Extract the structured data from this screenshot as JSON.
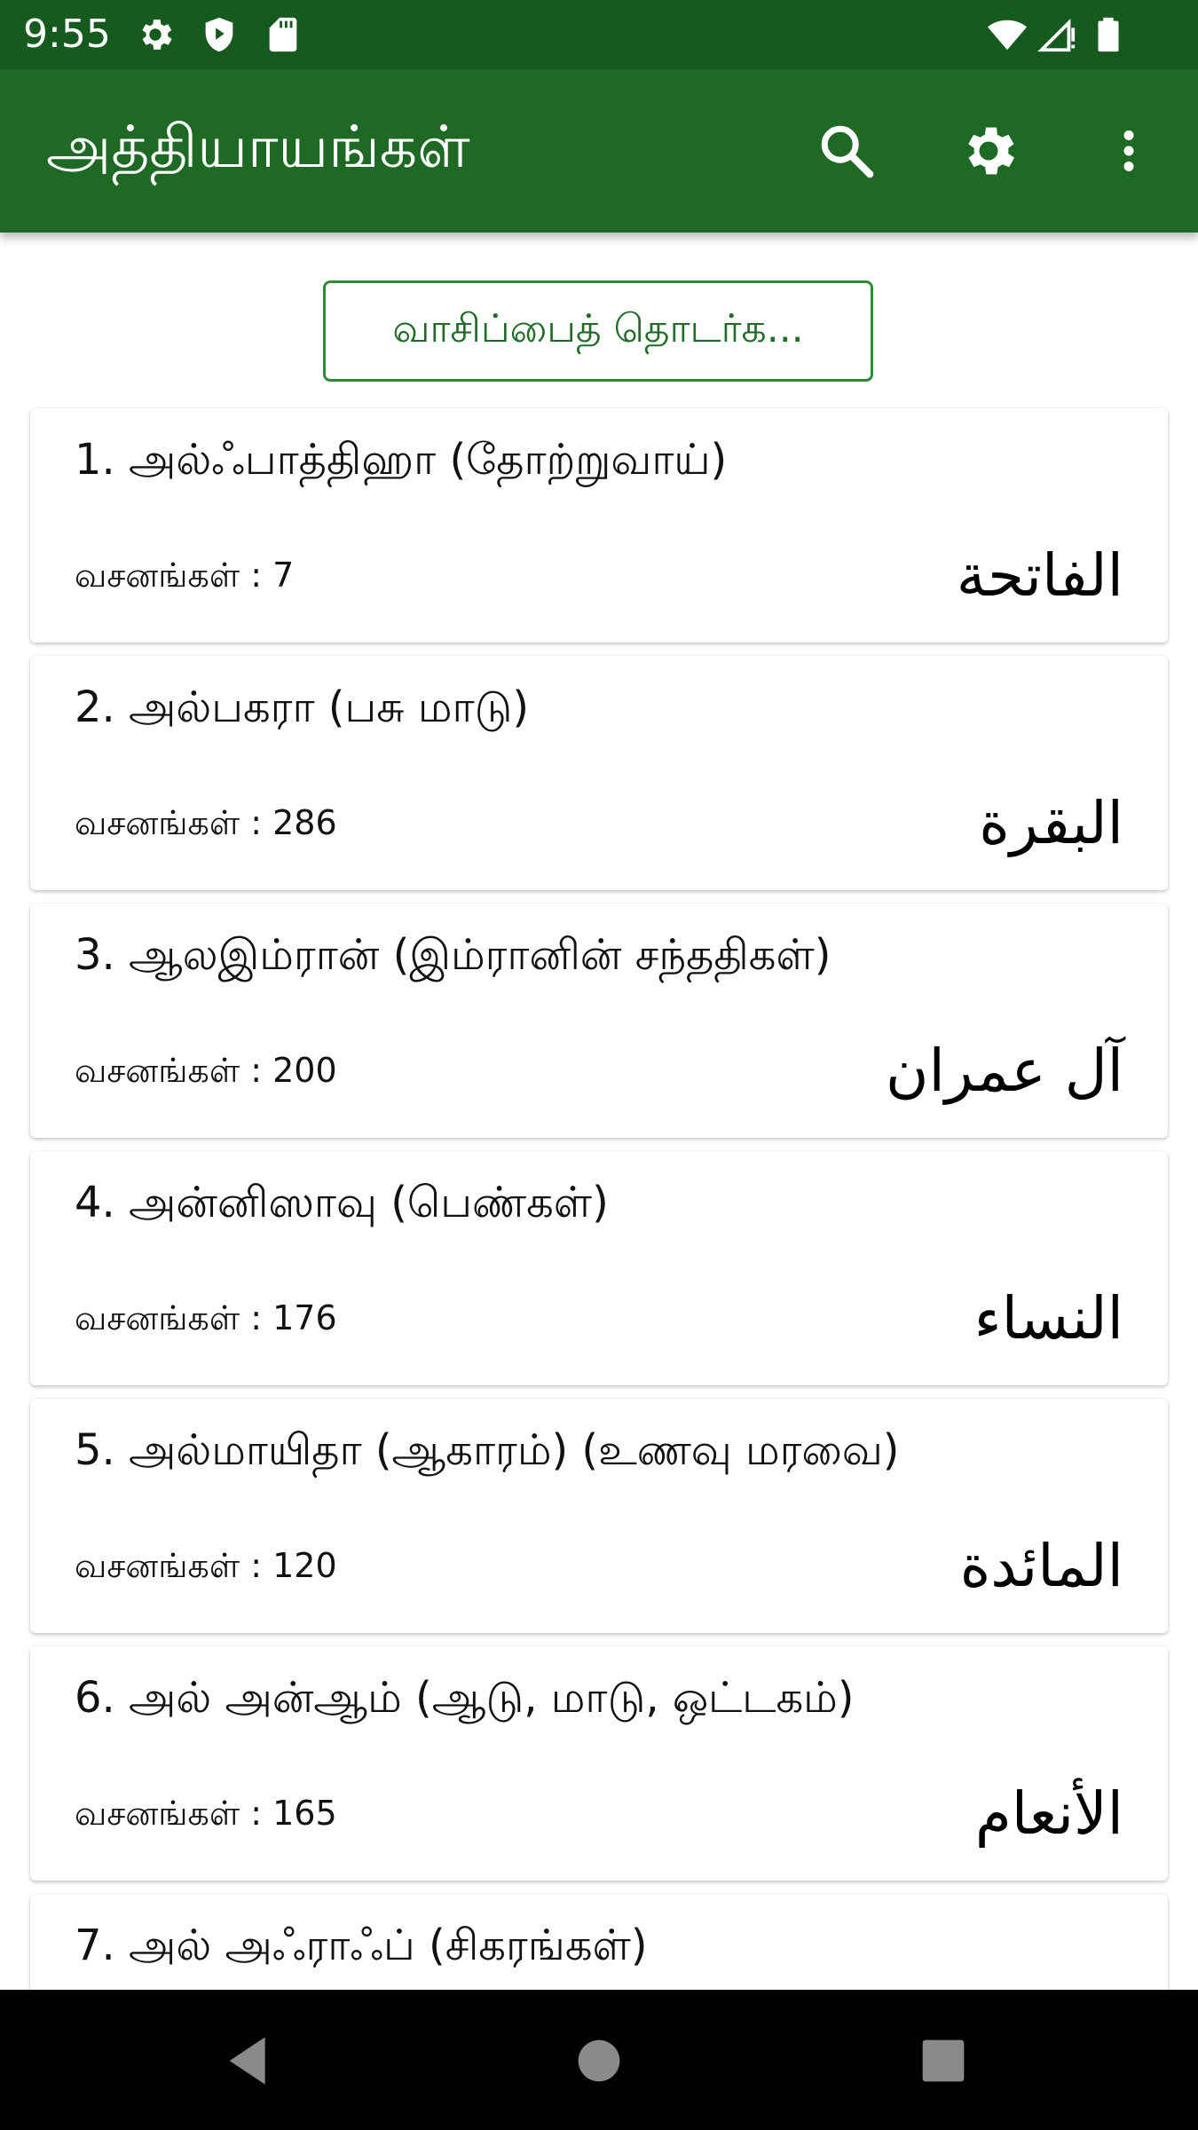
{
  "status_bar": {
    "time": "9:55",
    "icons": [
      "settings-gear-icon",
      "shield-icon",
      "sd-card-icon",
      "wifi-icon",
      "signal-icon",
      "battery-icon"
    ]
  },
  "app_bar": {
    "title": "அத்தியாயங்கள்",
    "actions": [
      "search-icon",
      "settings-icon",
      "more-vert-icon"
    ],
    "color": "#1e6a24"
  },
  "continue_button": {
    "label": "வாசிப்பைத் தொடர்க..."
  },
  "chapters": [
    {
      "title": "1. அல்ஃபாத்திஹா (தோற்றுவாய்)",
      "verses_label": "வசனங்கள் : 7",
      "arabic": "الفاتحة"
    },
    {
      "title": "2. அல்பகரா (பசு மாடு)",
      "verses_label": "வசனங்கள் : 286",
      "arabic": "البقرة"
    },
    {
      "title": "3. ஆலஇம்ரான் (இம்ரானின் சந்ததிகள்)",
      "verses_label": "வசனங்கள் : 200",
      "arabic": "آل عمران"
    },
    {
      "title": "4. அன்னிஸாவு (பெண்கள்)",
      "verses_label": "வசனங்கள் : 176",
      "arabic": "النساء"
    },
    {
      "title": "5. அல்மாயிதா (ஆகாரம்) (உணவு மரவை)",
      "verses_label": "வசனங்கள் : 120",
      "arabic": "المائدة"
    },
    {
      "title": "6. அல் அன்ஆம் (ஆடு, மாடு, ஒட்டகம்)",
      "verses_label": "வசனங்கள் : 165",
      "arabic": "الأنعام"
    },
    {
      "title": "7. அல் அஃராஃப் (சிகரங்கள்)",
      "verses_label": "",
      "arabic": ""
    }
  ],
  "nav_bar": {
    "buttons": [
      "back-icon",
      "home-icon",
      "recents-icon"
    ]
  }
}
